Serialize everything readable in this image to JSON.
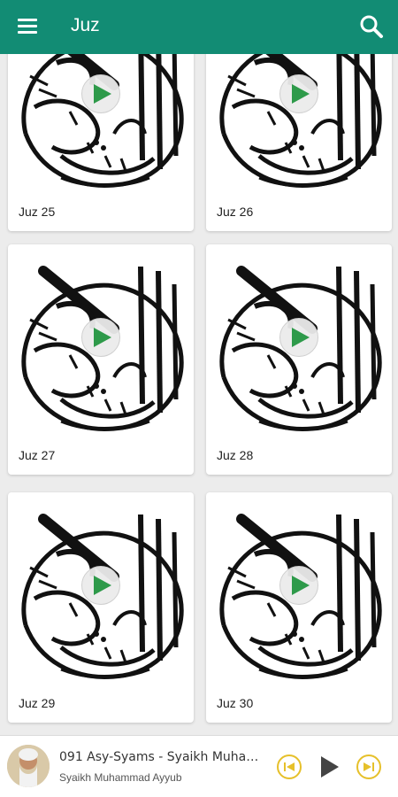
{
  "app_bar": {
    "title": "Juz",
    "menu_icon": "hamburger-menu-icon",
    "search_icon": "search-icon",
    "color": "#128c74"
  },
  "grid": {
    "cards": [
      {
        "label": "Juz 25"
      },
      {
        "label": "Juz 26"
      },
      {
        "label": "Juz 27"
      },
      {
        "label": "Juz 28"
      },
      {
        "label": "Juz 29"
      },
      {
        "label": "Juz 30"
      }
    ],
    "play_icon": "play-circle-icon",
    "play_color": "#2e9a4a"
  },
  "player": {
    "track_title": "091 Asy-Syams - Syaikh Muhammad Ayyub",
    "artist": "Syaikh Muhammad Ayyub",
    "controls": [
      "previous-icon",
      "play-icon",
      "next-icon"
    ],
    "accent": "#e6c02a"
  }
}
